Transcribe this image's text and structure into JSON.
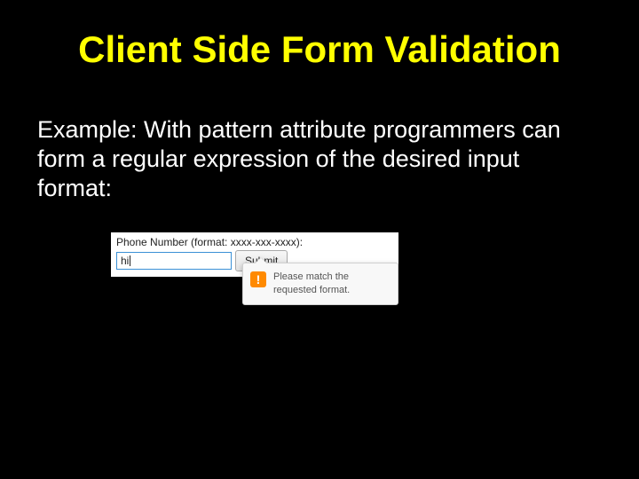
{
  "title": "Client Side Form Validation",
  "body": "Example: With pattern attribute programmers can form a regular expression of the desired input format:",
  "screenshot": {
    "label": "Phone Number (format: xxxx-xxx-xxxx):",
    "input_value": "hi",
    "submit_label": "Submit",
    "tooltip": {
      "icon_glyph": "!",
      "message": "Please match the requested format."
    }
  }
}
